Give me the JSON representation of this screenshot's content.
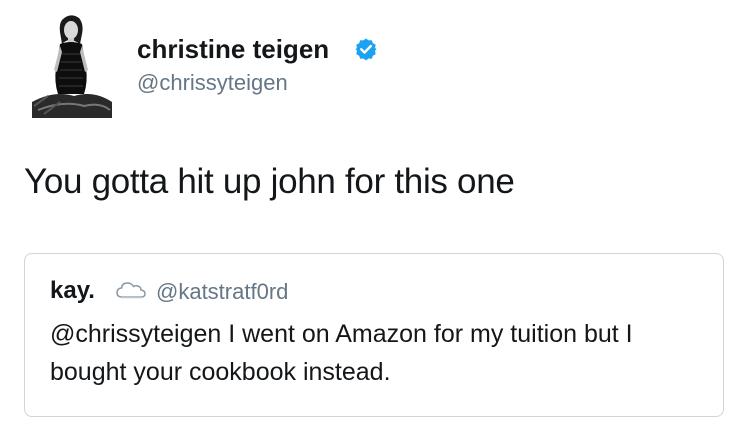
{
  "tweet": {
    "display_name": "christine teigen",
    "handle": "@chrissyteigen",
    "verified": true,
    "text": "You gotta hit up john for this one"
  },
  "quoted_tweet": {
    "display_name": "kay.",
    "name_icon": "cloud-icon",
    "handle": "@katstratf0rd",
    "text": "@chrissyteigen I went on Amazon for my tuition but I bought your cookbook instead."
  },
  "colors": {
    "verified_blue": "#1da1f2",
    "secondary_text": "#657786",
    "border": "#ccd6dd"
  }
}
